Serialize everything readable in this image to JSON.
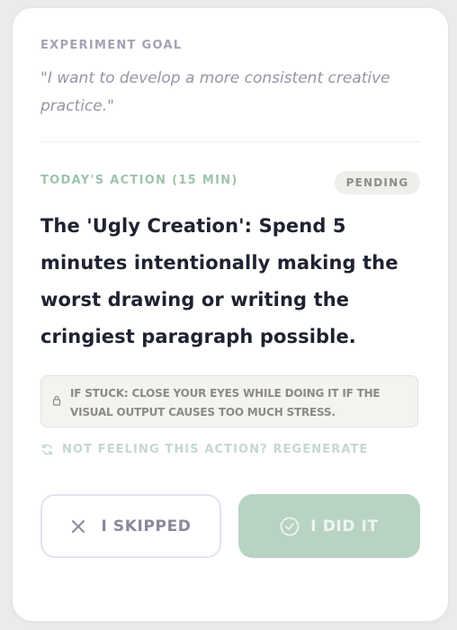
{
  "goal": {
    "label": "EXPERIMENT GOAL",
    "quote": "\"I want to develop a more consistent creative practice.\""
  },
  "action": {
    "label": "TODAY'S ACTION (15 MIN)",
    "status": "PENDING",
    "text": "The 'Ugly Creation': Spend 5 minutes intentionally making the worst drawing or writing the cringiest paragraph possible."
  },
  "tip": {
    "icon": "lock-icon",
    "text": "IF STUCK: CLOSE YOUR EYES WHILE DOING IT IF THE VISUAL OUTPUT CAUSES TOO MUCH STRESS."
  },
  "regenerate": {
    "icon": "refresh-icon",
    "label": "NOT FEELING THIS ACTION? REGENERATE"
  },
  "buttons": {
    "skip": {
      "icon": "close-icon",
      "label": "I SKIPPED"
    },
    "done": {
      "icon": "check-circle-icon",
      "label": "I DID IT"
    }
  },
  "colors": {
    "accent_green": "#b9d3c3",
    "label_green": "#9ec3ac",
    "text_dark": "#1f2230",
    "muted": "#a3a3b5"
  }
}
